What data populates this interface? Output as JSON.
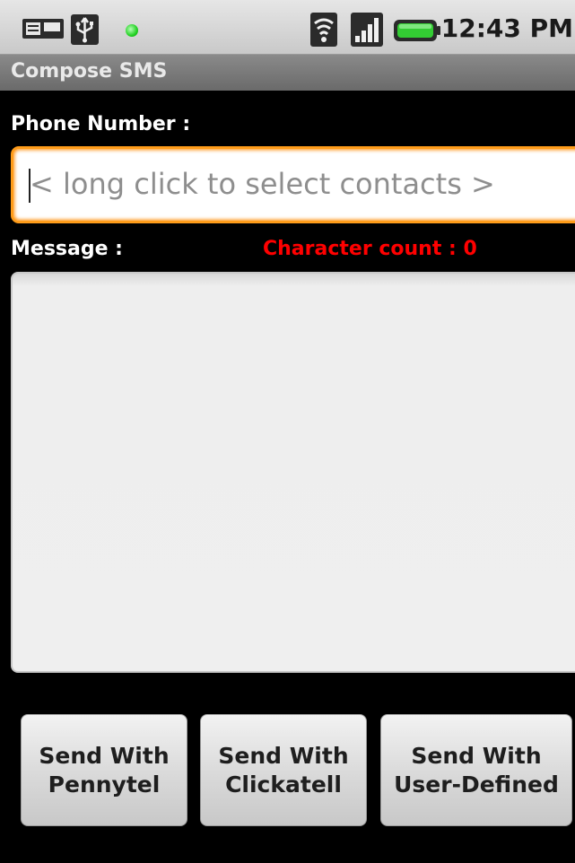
{
  "status_bar": {
    "icons": [
      "sim-card-icon",
      "usb-icon",
      "led-dot-icon",
      "wifi-icon",
      "signal-icon",
      "battery-icon"
    ],
    "time": "12:43 PM",
    "battery_color": "#33cc33"
  },
  "app": {
    "title": "Compose SMS"
  },
  "form": {
    "phone_label": "Phone Number :",
    "phone_placeholder": "< long click to select contacts >",
    "phone_value": "",
    "message_label": "Message :",
    "character_count": "Character count : 0",
    "message_value": ""
  },
  "buttons": [
    {
      "line1": "Send With",
      "line2": "Pennytel"
    },
    {
      "line1": "Send With",
      "line2": "Clickatell"
    },
    {
      "line1": "Send With",
      "line2": "User-Defined"
    }
  ],
  "colors": {
    "focus_border": "#ff9c1a",
    "character_count": "#ff0000",
    "background": "#000000"
  }
}
